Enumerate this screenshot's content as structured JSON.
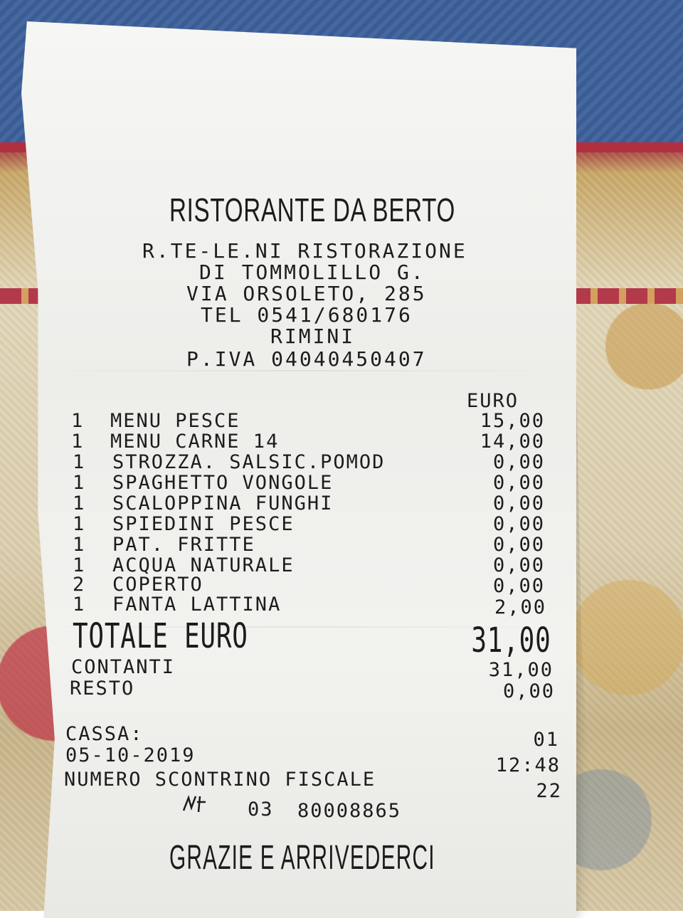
{
  "receipt": {
    "title": "RISTORANTE DA BERTO",
    "header_lines": [
      "R.TE-LE.NI RISTORAZIONE",
      "DI TOMMOLILLO G.",
      "VIA ORSOLETO, 285",
      "TEL 0541/680176",
      "RIMINI",
      "P.IVA 04040450407"
    ],
    "currency_label": "EURO",
    "items": [
      {
        "qty": "1",
        "name": "MENU PESCE",
        "price": "15,00"
      },
      {
        "qty": "1",
        "name": "MENU CARNE 14",
        "price": "14,00"
      },
      {
        "qty": "1",
        "name": "STROZZA. SALSIC.POMOD",
        "price": "0,00"
      },
      {
        "qty": "1",
        "name": "SPAGHETTO VONGOLE",
        "price": "0,00"
      },
      {
        "qty": "1",
        "name": "SCALOPPINA FUNGHI",
        "price": "0,00"
      },
      {
        "qty": "1",
        "name": "SPIEDINI PESCE",
        "price": "0,00"
      },
      {
        "qty": "1",
        "name": "PAT. FRITTE",
        "price": "0,00"
      },
      {
        "qty": "1",
        "name": "ACQUA NATURALE",
        "price": "0,00"
      },
      {
        "qty": "2",
        "name": "COPERTO",
        "price": "0,00"
      },
      {
        "qty": "1",
        "name": "FANTA LATTINA",
        "price": "2,00"
      }
    ],
    "total_label": "TOTALE EURO",
    "total_value": "31,00",
    "cash_label": "CONTANTI",
    "cash_value": "31,00",
    "change_label": "RESTO",
    "change_value": "0,00",
    "register_label": "CASSA:",
    "register_value": "01",
    "date": "05-10-2019",
    "time": "12:48",
    "fiscal_label": "NUMERO SCONTRINO FISCALE",
    "fiscal_value": "22",
    "serial_prefix": "03",
    "serial_number": "80008865",
    "footer": "GRAZIE E ARRIVEDERCI"
  }
}
